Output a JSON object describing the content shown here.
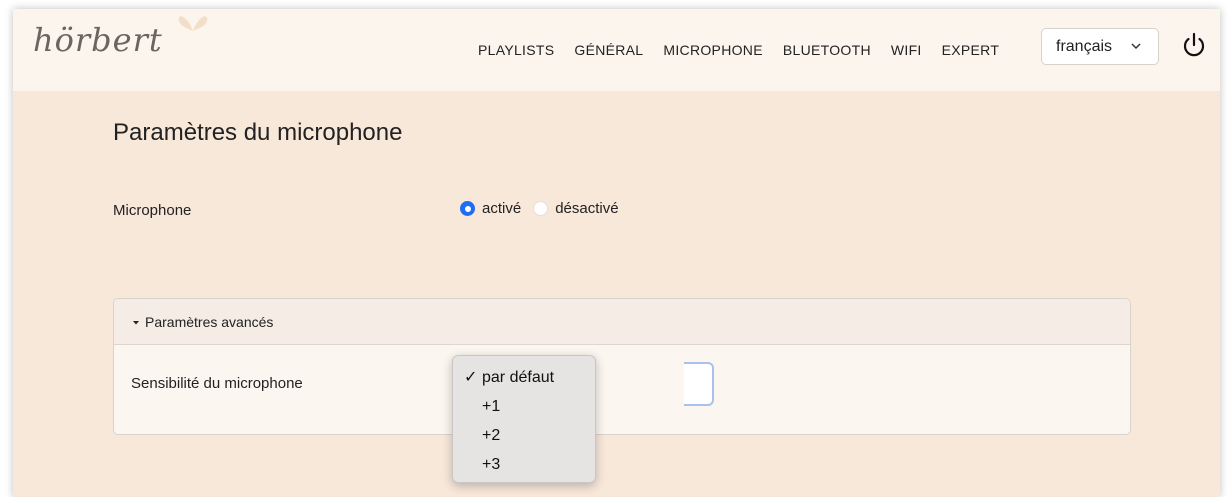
{
  "brand": {
    "logo_text": "hörbert"
  },
  "nav": {
    "links": [
      "PLAYLISTS",
      "GÉNÉRAL",
      "MICROPHONE",
      "BLUETOOTH",
      "WIFI",
      "EXPERT"
    ],
    "language": "français"
  },
  "icons": {
    "power": "power-icon",
    "chevron": "chevron-down-icon",
    "caret": "caret-down-icon",
    "check": "check-icon"
  },
  "page": {
    "title": "Paramètres du microphone",
    "microphone_label": "Microphone",
    "radio_options": [
      {
        "label": "activé",
        "selected": true
      },
      {
        "label": "désactivé",
        "selected": false
      }
    ]
  },
  "advanced": {
    "header": "Paramètres avancés",
    "sensitivity_label": "Sensibilité du microphone",
    "options": [
      "par défaut",
      "+1",
      "+2",
      "+3"
    ],
    "selected_option": "par défaut"
  },
  "colors": {
    "accent": "#1d6ef5",
    "page_bg": "#f8e8da",
    "navbar_bg": "#fbf5ee"
  }
}
